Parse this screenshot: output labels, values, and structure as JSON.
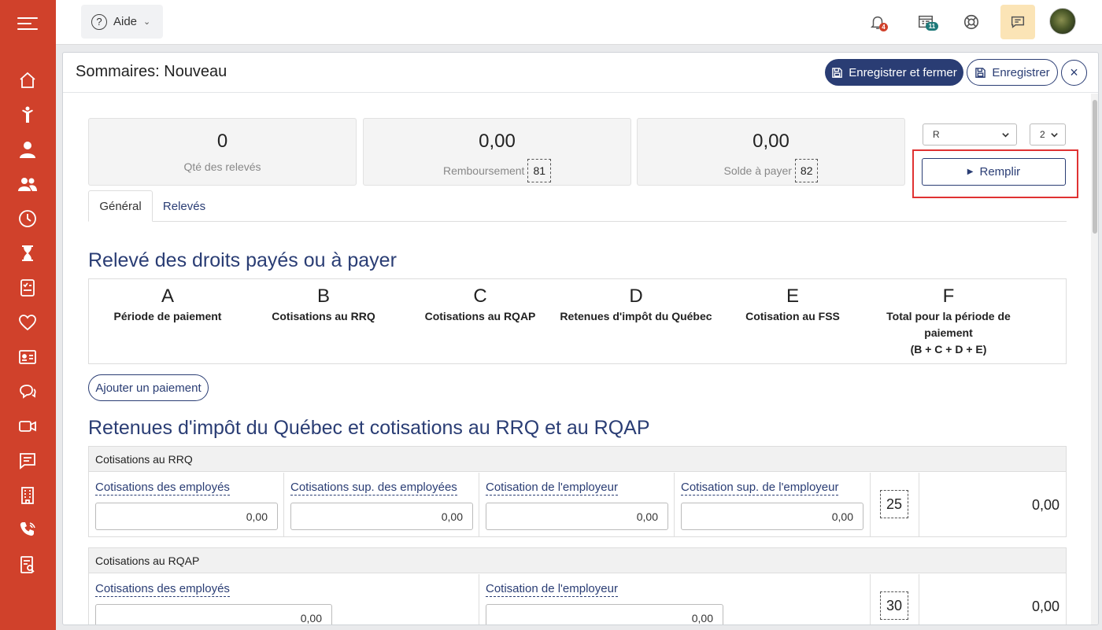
{
  "topbar": {
    "help_label": "Aide",
    "notif_badge": "4",
    "reports_badge": "11"
  },
  "modal": {
    "title": "Sommaires: Nouveau",
    "save_close_label": "Enregistrer et fermer",
    "save_label": "Enregistrer",
    "close_icon": "×"
  },
  "summary": {
    "qty_value": "0",
    "qty_label": "Qté des relevés",
    "refund_value": "0,00",
    "refund_label": "Remboursement",
    "refund_box": "81",
    "balance_value": "0,00",
    "balance_label": "Solde à payer",
    "balance_box": "82"
  },
  "controls": {
    "type_select": "R",
    "number_select": "2",
    "fill_label": "Remplir"
  },
  "tabs": {
    "general": "Général",
    "releves": "Relevés"
  },
  "payments": {
    "heading": "Relevé des droits payés ou à payer",
    "columns": [
      {
        "letter": "A",
        "label": "Période de paiement"
      },
      {
        "letter": "B",
        "label": "Cotisations au RRQ"
      },
      {
        "letter": "C",
        "label": "Cotisations au RQAP"
      },
      {
        "letter": "D",
        "label": "Retenues d'impôt du Québec"
      },
      {
        "letter": "E",
        "label": "Cotisation au FSS"
      },
      {
        "letter": "F",
        "label": "Total pour la période de paiement",
        "label2": "(B + C + D + E)"
      }
    ],
    "add_label": "Ajouter un paiement"
  },
  "withholdings": {
    "heading": "Retenues d'impôt du Québec et cotisations au RRQ et au RQAP",
    "rrq": {
      "title": "Cotisations au RRQ",
      "fields": [
        {
          "label": "Cotisations des employés",
          "value": "0,00"
        },
        {
          "label": "Cotisations sup. des employées",
          "value": "0,00"
        },
        {
          "label": "Cotisation de l'employeur",
          "value": "0,00"
        },
        {
          "label": "Cotisation sup. de l'employeur",
          "value": "0,00"
        }
      ],
      "box": "25",
      "total": "0,00"
    },
    "rqap": {
      "title": "Cotisations au RQAP",
      "fields": [
        {
          "label": "Cotisations des employés",
          "value": "0,00"
        },
        {
          "label": "Cotisation de l'employeur",
          "value": "0,00"
        }
      ],
      "box": "30",
      "total": "0,00"
    }
  },
  "colors": {
    "sidebar": "#d0412b",
    "primary": "#2a3d74",
    "highlight": "#e03232",
    "chat_bg": "#fbe4b6"
  },
  "icons": [
    "menu-icon",
    "home-icon",
    "person-raise-icon",
    "user-icon",
    "users-icon",
    "clock-icon",
    "hourglass-icon",
    "checklist-icon",
    "heart-icon",
    "id-card-icon",
    "chat-icon",
    "video-icon",
    "message-icon",
    "building-icon",
    "phone-icon",
    "report-icon",
    "help-icon",
    "bell-icon",
    "reports-icon",
    "support-icon",
    "save-icon"
  ]
}
